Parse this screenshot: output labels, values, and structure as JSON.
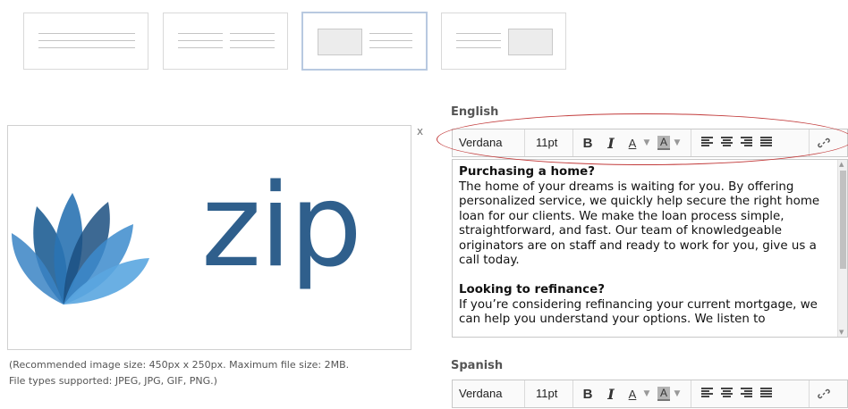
{
  "layout_options": [
    {
      "name": "text-only"
    },
    {
      "name": "two-columns"
    },
    {
      "name": "image-left-text-right",
      "selected": true
    },
    {
      "name": "text-left-image-right"
    }
  ],
  "image": {
    "logo_text": "zip",
    "close_label": "x",
    "note_line1": "(Recommended image size: 450px x 250px. Maximum file size: 2MB.",
    "note_line2": "File types supported: JPEG, JPG, GIF, PNG.)"
  },
  "english": {
    "label": "English",
    "toolbar": {
      "font": "Verdana",
      "size": "11pt",
      "bold": "B",
      "italic": "I",
      "text_color": "A",
      "highlight": "A",
      "caret": "▼"
    },
    "content": {
      "heading1": "Purchasing a home?",
      "para1": "The home of your dreams is waiting for you. By offering personalized service, we quickly help secure the right home loan for our clients. We make the loan process simple, straightforward, and fast. Our team of knowledgeable originators are on staff and ready to work for you, give us a call today.",
      "heading2": "Looking to refinance?",
      "para2": "If you’re considering refinancing your current mortgage, we can help you understand your options. We listen to"
    }
  },
  "spanish": {
    "label": "Spanish",
    "toolbar": {
      "font": "Verdana",
      "size": "11pt",
      "bold": "B",
      "italic": "I",
      "text_color": "A",
      "highlight": "A",
      "caret": "▼"
    }
  },
  "colors": {
    "accent_oval": "#c23a3a",
    "logo_blue": "#2f5f8c",
    "leaf_light": "#3f8fd0"
  }
}
